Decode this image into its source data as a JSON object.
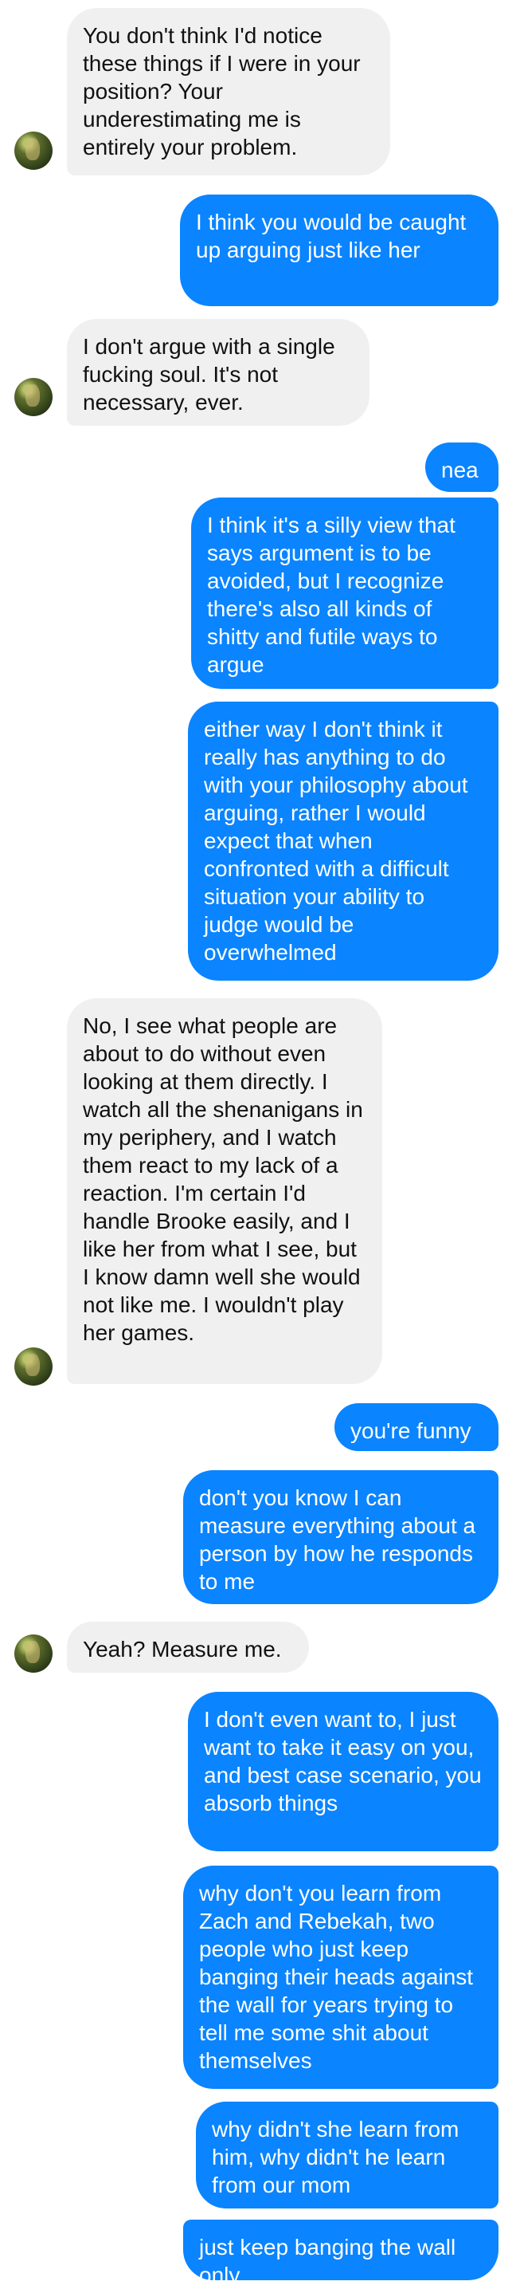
{
  "messages": [
    {
      "side": "in",
      "text": "You don't think I'd notice these things if I were in your position? Your underestimating me is entirely your problem.",
      "avatar": true
    },
    {
      "side": "out",
      "text": "I think you would be caught up arguing just like her"
    },
    {
      "side": "in",
      "text": "I don't argue with a single fucking soul. It's not necessary, ever.",
      "avatar": true
    },
    {
      "side": "out",
      "text": "neat"
    },
    {
      "side": "out",
      "text": "I think it's a silly view that says argument is to be avoided, but I recognize there's also all kinds of shitty and futile ways to argue"
    },
    {
      "side": "out",
      "text": "either way I don't think it really has anything to do with your philosophy about arguing, rather I would expect that when confronted with a difficult situation your ability to judge would be overwhelmed"
    },
    {
      "side": "in",
      "text": "No, I see what people are about to do without even looking at them directly. I watch all the shenanigans in my periphery, and I watch them react to my lack of a reaction. I'm certain I'd handle Brooke easily, and I like her from what I see, but I know damn well she would not like me. I wouldn't play her games.",
      "avatar": true
    },
    {
      "side": "out",
      "text": "you're funny"
    },
    {
      "side": "out",
      "text": "don't you know I can measure everything about a person by how he responds to me"
    },
    {
      "side": "in",
      "text": "Yeah? Measure me.",
      "avatar": true
    },
    {
      "side": "out",
      "text": "I don't even want to, I just want to take it easy on you, and best case scenario, you absorb things"
    },
    {
      "side": "out",
      "text": "why don't you learn from Zach and Rebekah, two people who just keep banging their heads against the wall for years trying to tell me some shit about themselves"
    },
    {
      "side": "out",
      "text": "why didn't she learn from him, why didn't he learn from our mom"
    },
    {
      "side": "out",
      "text": "just keep banging the wall only"
    }
  ],
  "colors": {
    "incoming_bubble": "#f1f0f0",
    "outgoing_bubble": "#0a84ff",
    "incoming_text": "#111111",
    "outgoing_text": "#ffffff"
  }
}
